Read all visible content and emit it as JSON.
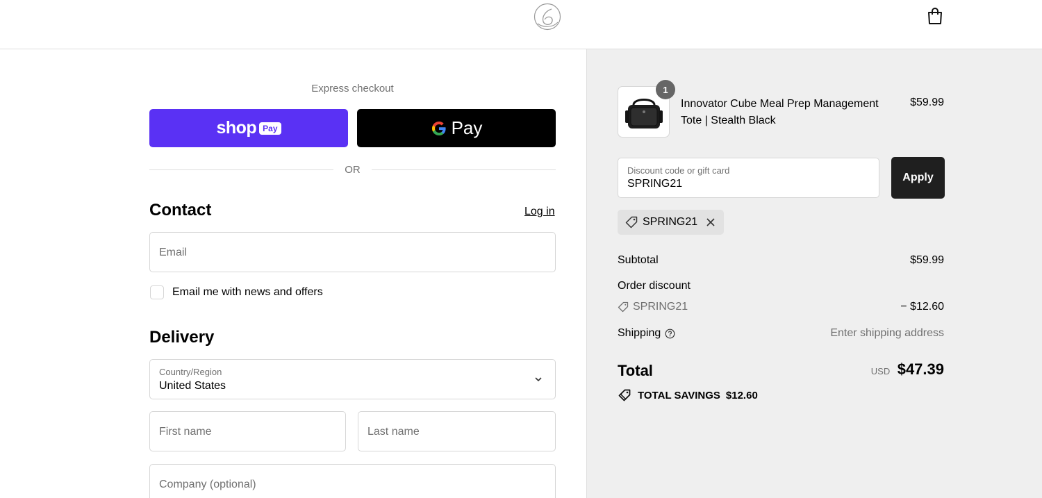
{
  "header": {
    "logo": "brand-logo",
    "cart_icon": "shopping-bag-icon"
  },
  "express": {
    "label": "Express checkout",
    "shop_pay_word": "shop",
    "shop_pay_pill": "Pay",
    "gpay_label": "Pay",
    "or": "OR"
  },
  "contact": {
    "heading": "Contact",
    "login": "Log in",
    "email_placeholder": "Email",
    "newsletter_label": "Email me with news and offers"
  },
  "delivery": {
    "heading": "Delivery",
    "country_label": "Country/Region",
    "country_value": "United States",
    "first_name_placeholder": "First name",
    "last_name_placeholder": "Last name",
    "company_placeholder": "Company (optional)"
  },
  "summary": {
    "item": {
      "name": "Innovator Cube Meal Prep Management Tote | Stealth Black",
      "price": "$59.99",
      "quantity": "1"
    },
    "discount": {
      "label": "Discount code or gift card",
      "value": "SPRING21",
      "apply": "Apply",
      "applied_code": "SPRING21"
    },
    "subtotal_label": "Subtotal",
    "subtotal_value": "$59.99",
    "order_discount_label": "Order discount",
    "order_discount_code": "SPRING21",
    "order_discount_value": "− $12.60",
    "shipping_label": "Shipping",
    "shipping_value": "Enter shipping address",
    "total_label": "Total",
    "currency": "USD",
    "total_value": "$47.39",
    "savings_label": "TOTAL SAVINGS",
    "savings_value": "$12.60"
  }
}
